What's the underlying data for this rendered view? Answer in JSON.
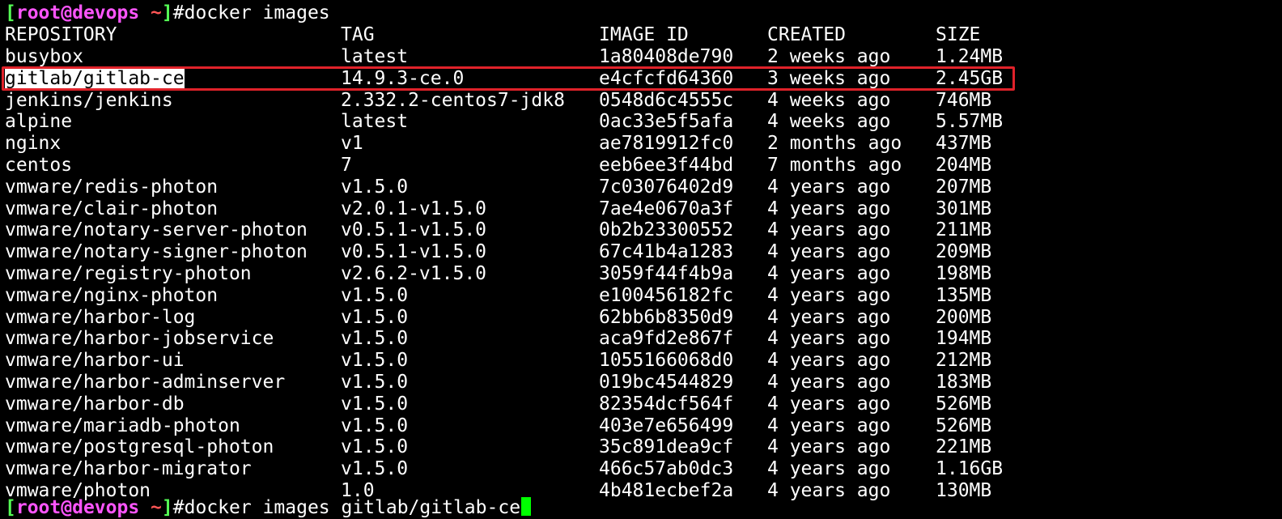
{
  "window": {
    "background": "#000000",
    "accent_box_color": "#e0222a",
    "cursor_color": "#00ff00"
  },
  "prompt1": {
    "open_bracket": "[",
    "user": "root",
    "at": "@",
    "host": "devops",
    "dir": " ~",
    "close_bracket": "]",
    "symbol": "#",
    "command": "docker images"
  },
  "header": {
    "repository": "REPOSITORY",
    "tag": "TAG",
    "image_id": "IMAGE ID",
    "created": "CREATED",
    "size": "SIZE"
  },
  "rows": [
    {
      "repository": "busybox",
      "tag": "latest",
      "image_id": "1a80408de790",
      "created": "2 weeks ago",
      "size": "1.24MB"
    },
    {
      "repository": "gitlab/gitlab-ce",
      "tag": "14.9.3-ce.0",
      "image_id": "e4cfcfd64360",
      "created": "3 weeks ago",
      "size": "2.45GB"
    },
    {
      "repository": "jenkins/jenkins",
      "tag": "2.332.2-centos7-jdk8",
      "image_id": "0548d6c4555c",
      "created": "4 weeks ago",
      "size": "746MB"
    },
    {
      "repository": "alpine",
      "tag": "latest",
      "image_id": "0ac33e5f5afa",
      "created": "4 weeks ago",
      "size": "5.57MB"
    },
    {
      "repository": "nginx",
      "tag": "v1",
      "image_id": "ae7819912fc0",
      "created": "2 months ago",
      "size": "437MB"
    },
    {
      "repository": "centos",
      "tag": "7",
      "image_id": "eeb6ee3f44bd",
      "created": "7 months ago",
      "size": "204MB"
    },
    {
      "repository": "vmware/redis-photon",
      "tag": "v1.5.0",
      "image_id": "7c03076402d9",
      "created": "4 years ago",
      "size": "207MB"
    },
    {
      "repository": "vmware/clair-photon",
      "tag": "v2.0.1-v1.5.0",
      "image_id": "7ae4e0670a3f",
      "created": "4 years ago",
      "size": "301MB"
    },
    {
      "repository": "vmware/notary-server-photon",
      "tag": "v0.5.1-v1.5.0",
      "image_id": "0b2b23300552",
      "created": "4 years ago",
      "size": "211MB"
    },
    {
      "repository": "vmware/notary-signer-photon",
      "tag": "v0.5.1-v1.5.0",
      "image_id": "67c41b4a1283",
      "created": "4 years ago",
      "size": "209MB"
    },
    {
      "repository": "vmware/registry-photon",
      "tag": "v2.6.2-v1.5.0",
      "image_id": "3059f44f4b9a",
      "created": "4 years ago",
      "size": "198MB"
    },
    {
      "repository": "vmware/nginx-photon",
      "tag": "v1.5.0",
      "image_id": "e100456182fc",
      "created": "4 years ago",
      "size": "135MB"
    },
    {
      "repository": "vmware/harbor-log",
      "tag": "v1.5.0",
      "image_id": "62bb6b8350d9",
      "created": "4 years ago",
      "size": "200MB"
    },
    {
      "repository": "vmware/harbor-jobservice",
      "tag": "v1.5.0",
      "image_id": "aca9fd2e867f",
      "created": "4 years ago",
      "size": "194MB"
    },
    {
      "repository": "vmware/harbor-ui",
      "tag": "v1.5.0",
      "image_id": "1055166068d0",
      "created": "4 years ago",
      "size": "212MB"
    },
    {
      "repository": "vmware/harbor-adminserver",
      "tag": "v1.5.0",
      "image_id": "019bc4544829",
      "created": "4 years ago",
      "size": "183MB"
    },
    {
      "repository": "vmware/harbor-db",
      "tag": "v1.5.0",
      "image_id": "82354dcf564f",
      "created": "4 years ago",
      "size": "526MB"
    },
    {
      "repository": "vmware/mariadb-photon",
      "tag": "v1.5.0",
      "image_id": "403e7e656499",
      "created": "4 years ago",
      "size": "526MB"
    },
    {
      "repository": "vmware/postgresql-photon",
      "tag": "v1.5.0",
      "image_id": "35c891dea9cf",
      "created": "4 years ago",
      "size": "221MB"
    },
    {
      "repository": "vmware/harbor-migrator",
      "tag": "v1.5.0",
      "image_id": "466c57ab0dc3",
      "created": "4 years ago",
      "size": "1.16GB"
    },
    {
      "repository": "vmware/photon",
      "tag": "1.0",
      "image_id": "4b481ecbef2a",
      "created": "4 years ago",
      "size": "130MB"
    }
  ],
  "prompt2": {
    "open_bracket": "[",
    "user": "root",
    "at": "@",
    "host": "devops",
    "dir": " ~",
    "close_bracket": "]",
    "symbol": "#",
    "command": "docker images gitlab/gitlab-ce"
  }
}
